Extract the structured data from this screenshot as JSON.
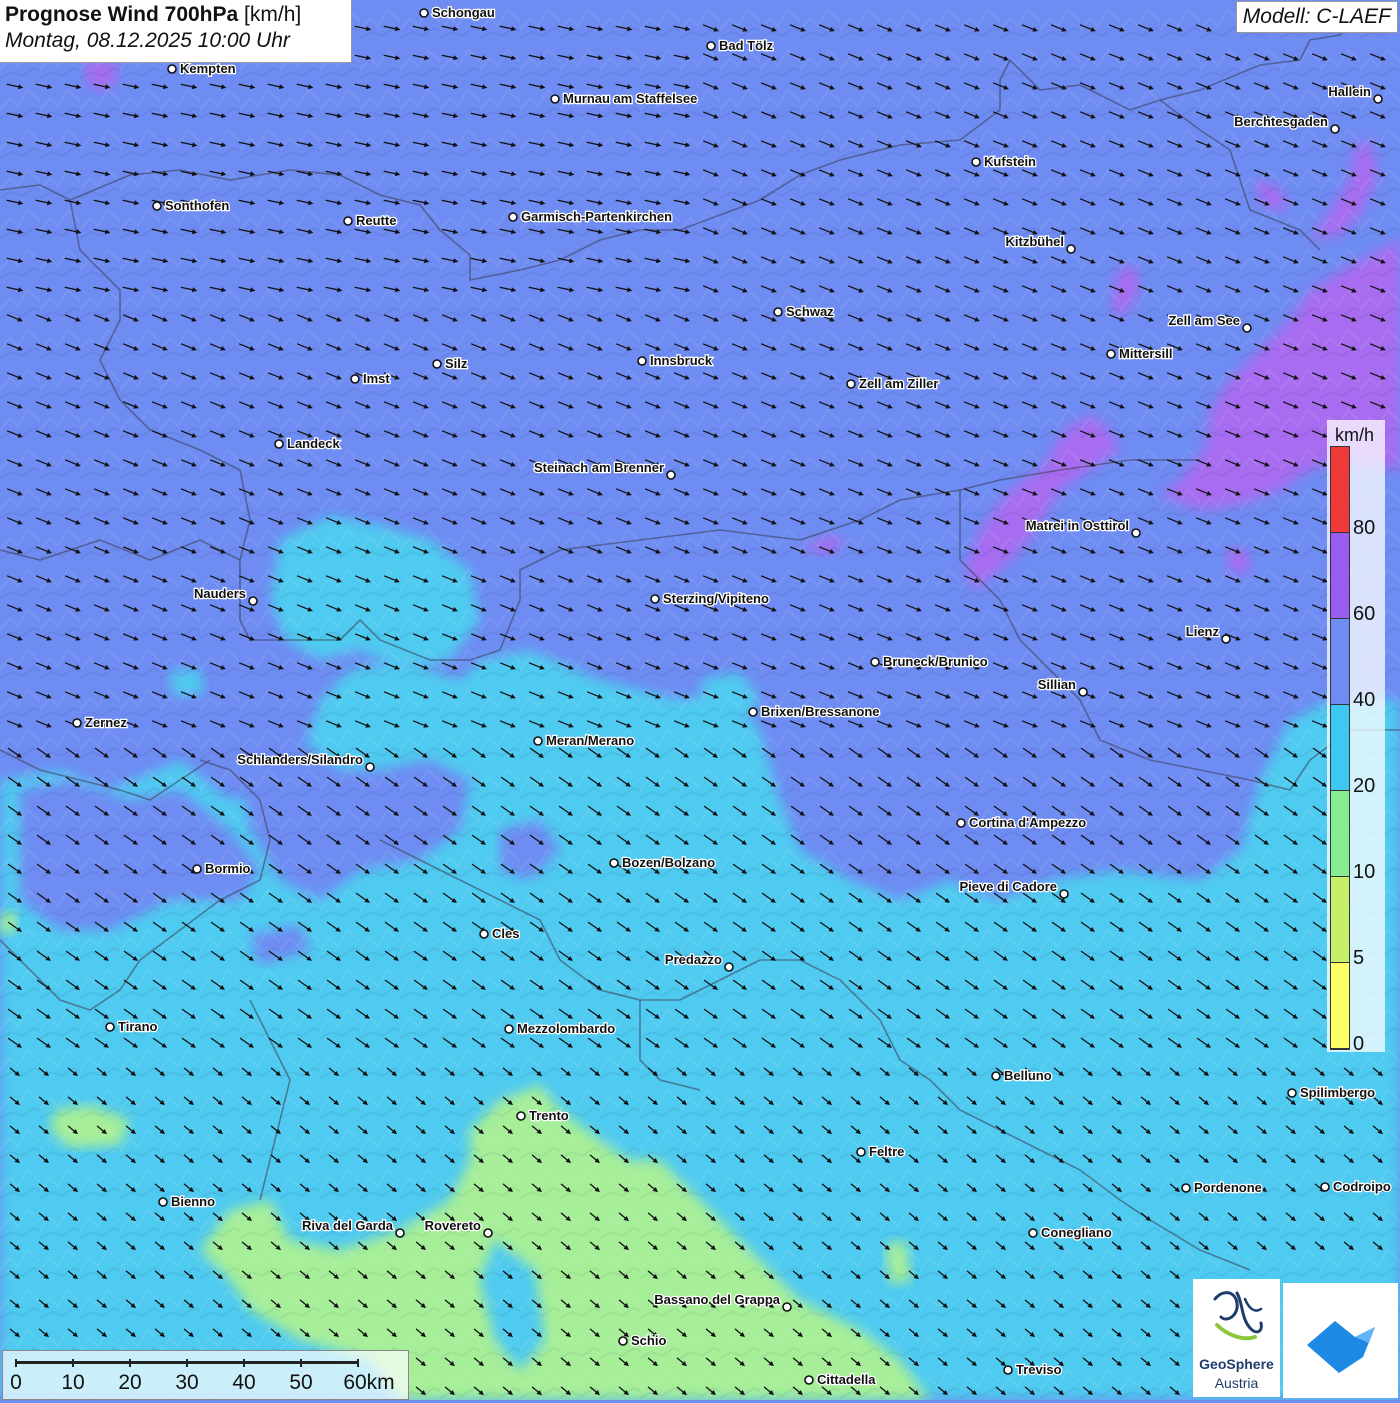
{
  "header": {
    "title_bold": "Prognose Wind 700hPa",
    "title_unit": "[km/h]",
    "subtitle": "Montag, 08.12.2025 10:00 Uhr",
    "model": "Modell: C-LAEF"
  },
  "legend": {
    "unit": "km/h",
    "labels": [
      "80",
      "60",
      "40",
      "20",
      "10",
      "5",
      "0"
    ],
    "colors": [
      "#f03a3a",
      "#9a5cf0",
      "#6e8cf2",
      "#3cc8f0",
      "#86ee90",
      "#c6f06a",
      "#ffff66"
    ]
  },
  "scale": {
    "labels": [
      "0",
      "10",
      "20",
      "30",
      "40",
      "50",
      "60km"
    ]
  },
  "logos": {
    "geosphere_name": "GeoSphere",
    "geosphere_sub": "Austria"
  },
  "wind": {
    "direction": "from north-west",
    "field_colors": {
      "purple_band": "#a76cf0",
      "blue_band": "#6e8cf2",
      "cyan_band": "#4fcaf0",
      "green_band": "#a6ee98"
    }
  },
  "cities": [
    {
      "name": "Schongau",
      "dot_side": "left"
    },
    {
      "name": "Bad Tölz",
      "dot_side": "left"
    },
    {
      "name": "Kempten",
      "dot_side": "left"
    },
    {
      "name": "Murnau am Staffelsee",
      "dot_side": "left"
    },
    {
      "name": "Hallein",
      "dot_side": "right"
    },
    {
      "name": "Berchtesgaden",
      "dot_side": "right"
    },
    {
      "name": "Kufstein",
      "dot_side": "left"
    },
    {
      "name": "Sonthofen",
      "dot_side": "left"
    },
    {
      "name": "Reutte",
      "dot_side": "left"
    },
    {
      "name": "Garmisch-Partenkirchen",
      "dot_side": "left"
    },
    {
      "name": "Kitzbühel",
      "dot_side": "right"
    },
    {
      "name": "Schwaz",
      "dot_side": "left"
    },
    {
      "name": "Zell am See",
      "dot_side": "right"
    },
    {
      "name": "Mittersill",
      "dot_side": "left"
    },
    {
      "name": "Innsbruck",
      "dot_side": "left"
    },
    {
      "name": "Silz",
      "dot_side": "left"
    },
    {
      "name": "Imst",
      "dot_side": "left"
    },
    {
      "name": "Zell am Ziller",
      "dot_side": "left"
    },
    {
      "name": "Landeck",
      "dot_side": "left"
    },
    {
      "name": "Steinach am Brenner",
      "dot_side": "right"
    },
    {
      "name": "Matrei in Osttirol",
      "dot_side": "right"
    },
    {
      "name": "Nauders",
      "dot_side": "right"
    },
    {
      "name": "Sterzing/Vipiteno",
      "dot_side": "left"
    },
    {
      "name": "Lienz",
      "dot_side": "right"
    },
    {
      "name": "Bruneck/Brunico",
      "dot_side": "left"
    },
    {
      "name": "Sillian",
      "dot_side": "right"
    },
    {
      "name": "Brixen/Bressanone",
      "dot_side": "left"
    },
    {
      "name": "Zernez",
      "dot_side": "left"
    },
    {
      "name": "Meran/Merano",
      "dot_side": "left"
    },
    {
      "name": "Schlanders/Silandro",
      "dot_side": "right"
    },
    {
      "name": "Cortina d'Ampezzo",
      "dot_side": "left"
    },
    {
      "name": "Bozen/Bolzano",
      "dot_side": "left"
    },
    {
      "name": "Bormio",
      "dot_side": "left"
    },
    {
      "name": "Pieve di Cadore",
      "dot_side": "right"
    },
    {
      "name": "Cles",
      "dot_side": "left"
    },
    {
      "name": "Predazzo",
      "dot_side": "right"
    },
    {
      "name": "Tirano",
      "dot_side": "left"
    },
    {
      "name": "Mezzolombardo",
      "dot_side": "left"
    },
    {
      "name": "Belluno",
      "dot_side": "left"
    },
    {
      "name": "Spilimbergo",
      "dot_side": "left"
    },
    {
      "name": "Trento",
      "dot_side": "left"
    },
    {
      "name": "Feltre",
      "dot_side": "left"
    },
    {
      "name": "Pordenone",
      "dot_side": "left"
    },
    {
      "name": "Codroipo",
      "dot_side": "left"
    },
    {
      "name": "Bienno",
      "dot_side": "left"
    },
    {
      "name": "Riva del Garda",
      "dot_side": "right"
    },
    {
      "name": "Rovereto",
      "dot_side": "right"
    },
    {
      "name": "Conegliano",
      "dot_side": "left"
    },
    {
      "name": "Bassano del Grappa",
      "dot_side": "right"
    },
    {
      "name": "Schio",
      "dot_side": "left"
    },
    {
      "name": "Treviso",
      "dot_side": "left"
    },
    {
      "name": "Cittadella",
      "dot_side": "left"
    }
  ]
}
